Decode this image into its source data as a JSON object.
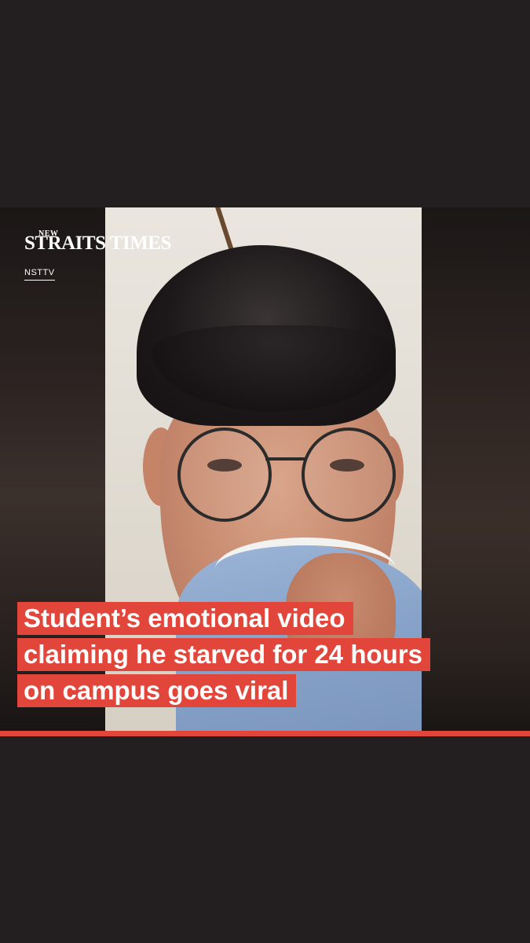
{
  "brand": {
    "superscript": "NEW",
    "name": "STRAITS TIMES",
    "section_tag": "NSTTV"
  },
  "headline": {
    "lines": [
      "Student’s emotional video",
      "claiming he starved for 24 hours",
      "on campus goes viral"
    ]
  },
  "colors": {
    "accent": "#e2463b",
    "background": "#231f20"
  }
}
